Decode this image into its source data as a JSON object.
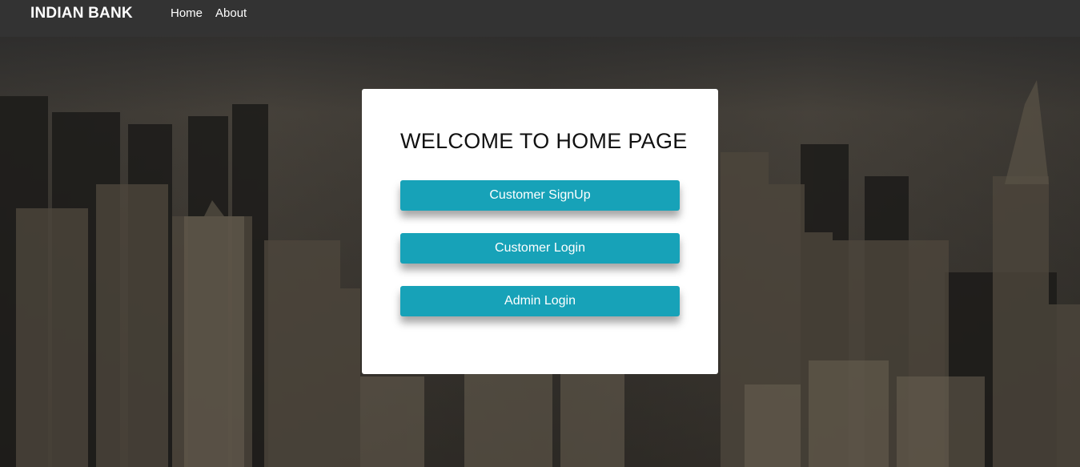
{
  "navbar": {
    "brand": "INDIAN BANK",
    "links": [
      "Home",
      "About"
    ]
  },
  "card": {
    "title": "WELCOME TO HOME PAGE",
    "buttons": [
      "Customer SignUp",
      "Customer Login",
      "Admin Login"
    ]
  },
  "colors": {
    "accent": "#17a2b8",
    "navbar": "#343434",
    "card": "#ffffff"
  },
  "background": "city-skyline-photo"
}
